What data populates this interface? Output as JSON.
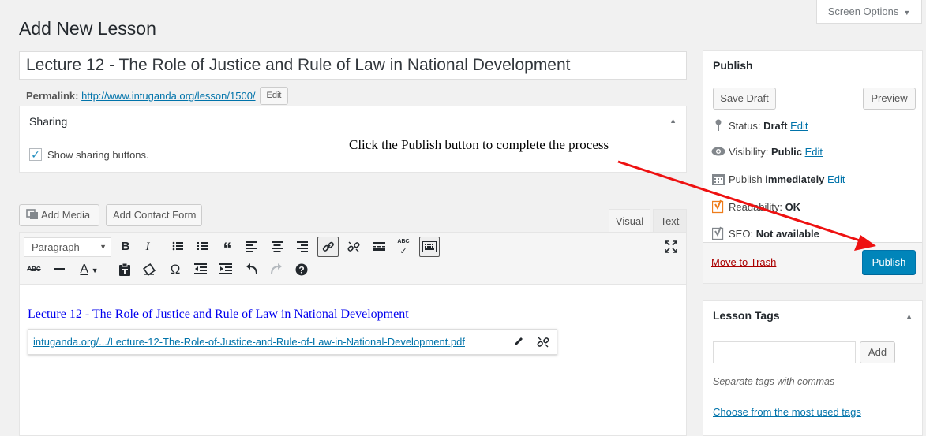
{
  "header": {
    "screen_options": "Screen Options",
    "page_title": "Add New Lesson"
  },
  "post": {
    "title": "Lecture 12 - The Role of Justice and Rule of Law in National Development",
    "permalink_label": "Permalink:",
    "permalink_url": "http://www.intuganda.org/lesson/1500/",
    "permalink_edit": "Edit"
  },
  "sharing": {
    "title": "Sharing",
    "checkbox_label": "Show sharing buttons.",
    "checked": true
  },
  "annotation": {
    "text": "Click the Publish button to complete the process",
    "arrow_color": "#ee1111"
  },
  "editor": {
    "add_media": "Add Media",
    "add_contact_form": "Add Contact Form",
    "tab_visual": "Visual",
    "tab_text": "Text",
    "format_select": "Paragraph",
    "toolbar_row1": [
      "bold-icon",
      "italic-icon",
      "bullet-list-icon",
      "numbered-list-icon",
      "blockquote-icon",
      "align-left-icon",
      "align-center-icon",
      "align-right-icon",
      "insert-link-icon",
      "unlink-icon",
      "read-more-icon",
      "spellcheck-icon",
      "toolbar-toggle-icon"
    ],
    "toolbar_row2": [
      "strikethrough-icon",
      "horizontal-line-icon",
      "text-color-icon",
      "paste-text-icon",
      "clear-formatting-icon",
      "special-character-icon",
      "outdent-icon",
      "indent-icon",
      "undo-icon",
      "redo-icon",
      "help-icon"
    ],
    "content_link_text": "Lecture 12 - The Role of Justice and Rule of Law in National Development",
    "link_popup_url": "intuganda.org/.../Lecture-12-The-Role-of-Justice-and-Rule-of-Law-in-National-Development.pdf"
  },
  "publish": {
    "title": "Publish",
    "save_draft": "Save Draft",
    "preview": "Preview",
    "status_label": "Status:",
    "status_value": "Draft",
    "status_edit": "Edit",
    "visibility_label": "Visibility:",
    "visibility_value": "Public",
    "visibility_edit": "Edit",
    "schedule_label": "Publish",
    "schedule_value": "immediately",
    "schedule_edit": "Edit",
    "readability_label": "Readability:",
    "readability_value": "OK",
    "seo_label": "SEO:",
    "seo_value": "Not available",
    "move_to_trash": "Move to Trash",
    "publish_button": "Publish",
    "accent_color": "#0085ba"
  },
  "tags": {
    "title": "Lesson Tags",
    "add_button": "Add",
    "help_text": "Separate tags with commas",
    "choose_link": "Choose from the most used tags"
  }
}
